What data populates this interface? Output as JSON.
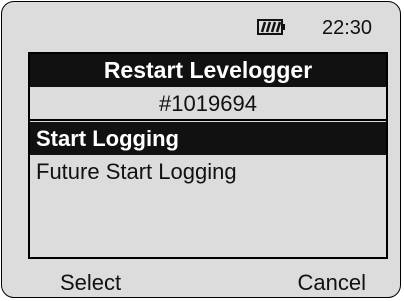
{
  "status": {
    "battery_icon": "battery-icon",
    "time": "22:30"
  },
  "screen": {
    "title": "Restart Levelogger",
    "serial": "#1019694",
    "menu_items": [
      {
        "label": "Start Logging",
        "selected": true
      },
      {
        "label": "Future Start Logging",
        "selected": false
      }
    ]
  },
  "softkeys": {
    "left": "Select",
    "right": "Cancel"
  },
  "colors": {
    "background": "#dcdcdc",
    "highlight": "#111111",
    "highlight_text": "#ffffff"
  }
}
